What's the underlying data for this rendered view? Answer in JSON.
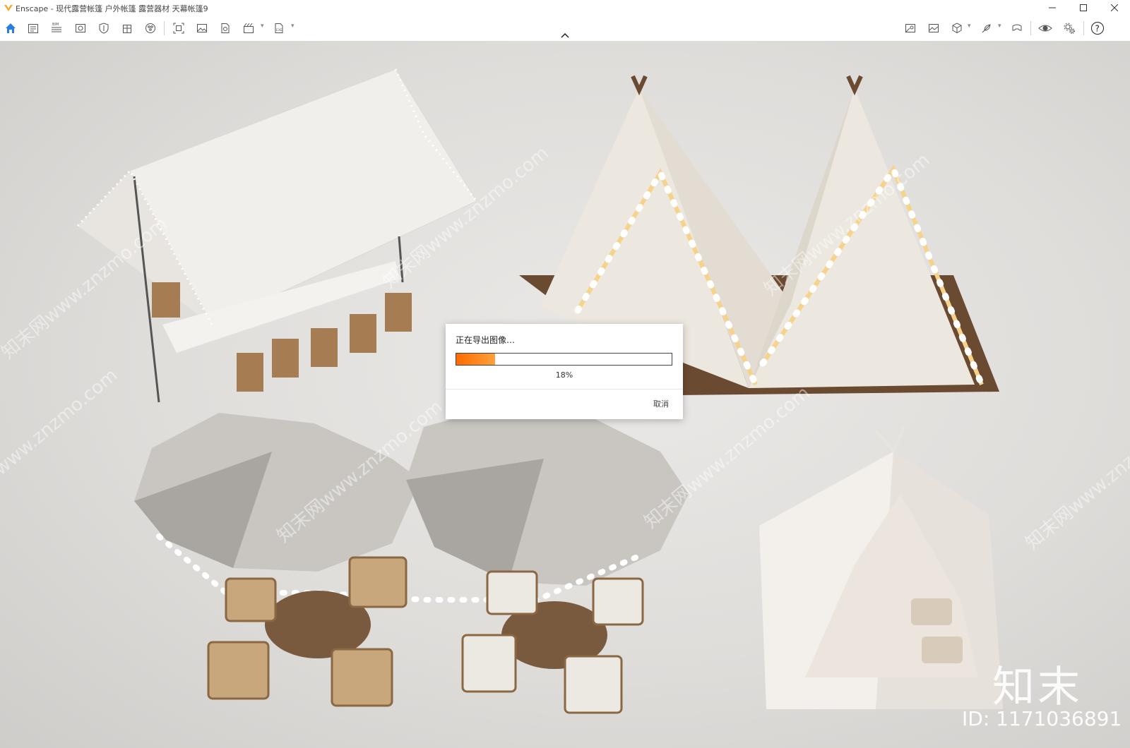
{
  "window": {
    "app_title": "Enscape - 现代露营帐篷 户外帐篷 露营器材 天幕帐篷9",
    "minimize_label": "—",
    "maximize_label": "☐",
    "close_label": "✕"
  },
  "toolbar": {
    "left_icons": [
      "home-icon",
      "document-icon",
      "bim-icon",
      "view-icon",
      "shield-icon",
      "building-icon",
      "materials-icon",
      "screenshot-icon",
      "image-icon",
      "export-icon",
      "video-icon",
      "exe-icon"
    ],
    "right_icons": [
      "map-icon",
      "gallery-icon",
      "cube-icon",
      "feather-icon",
      "vr-icon",
      "eye-icon",
      "settings-icon",
      "help-icon"
    ],
    "accent": "#2a7de1"
  },
  "dialog": {
    "title": "正在导出图像…",
    "progress_fraction": 0.18,
    "percent_label": "18%",
    "cancel_label": "取消",
    "progress_color": "#ff7a10"
  },
  "watermark": {
    "brand": "知末",
    "id_text": "ID: 1171036891",
    "diagonal_text": "知末网www.znzmo.com"
  }
}
